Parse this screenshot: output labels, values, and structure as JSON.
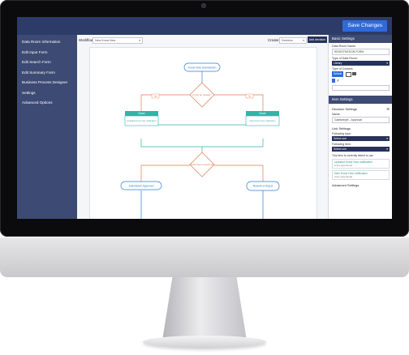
{
  "header": {
    "save_label": "Save Changes"
  },
  "sidebar": {
    "items": [
      {
        "label": "Data Room Information"
      },
      {
        "label": "Edit Input Form"
      },
      {
        "label": "Edit Search Form"
      },
      {
        "label": "Edit Summary Form"
      },
      {
        "label": "Business Process Designer"
      },
      {
        "label": "Settings"
      },
      {
        "label": "Advanced Options"
      }
    ]
  },
  "toolbar": {
    "workflow_label": "Workflow:",
    "workflow_value": "New Know New",
    "create_label": "Create:",
    "create_value": "Decision",
    "add_label": "Add decision"
  },
  "workflow": {
    "start_node": "Know How Submission",
    "decision1": "Is this an update?",
    "yes_label": "Yes",
    "no_label": "No",
    "email_title": "Email",
    "email_left": "Updated know how notification",
    "email_right": "New know how notification",
    "decision2": "Submission Approval",
    "left_node": "Submission Approved",
    "right_node": "Rework or Reject"
  },
  "panel": {
    "basic_title": "Basic Settings",
    "room_name_label": "Data Room Name:",
    "room_name_value": "REGISTRATION FORM",
    "type_label": "Type of Data Room:",
    "type_value": "Library",
    "content_label": "Type of Content:",
    "content_default": "Default",
    "item_title": "Item Settings",
    "decision_settings": "Decision Settings",
    "name_label": "Name:",
    "name_value": "Gatekeeper - Approval",
    "link_settings": "Link Settings",
    "following_type_label": "Following type:",
    "following_type_value": "Select one",
    "following_item_label": "Following item:",
    "following_item_value": "Select one",
    "linked_note": "This item is currently linked to use",
    "linked_items": [
      {
        "title": "Updated Know How notification",
        "sub": "Anne-type Email"
      },
      {
        "title": "New Know How notification",
        "sub": "Anne-type Email"
      }
    ],
    "advanced": "Advanced Settings"
  },
  "colors": {
    "navy": "#2c3b67",
    "sidebar": "#3d4a73",
    "accent_blue": "#2f6bd8",
    "flow_blue": "#2f7fd3",
    "flow_orange": "#e07a52",
    "flow_teal": "#33b3a8"
  }
}
